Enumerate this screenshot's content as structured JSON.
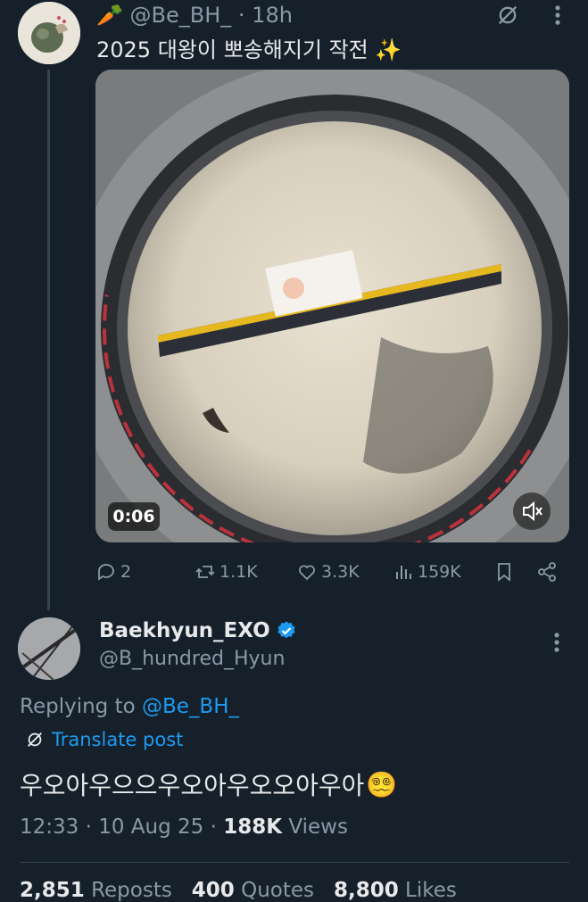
{
  "tweet1": {
    "carrot_emoji": "🥕",
    "handle": "@Be_BH_",
    "time": "· 18h",
    "text": "2025 대왕이 뽀송해지기 작전",
    "sparkle_emoji": "✨",
    "video_time": "0:06",
    "actions": {
      "replies": "2",
      "reposts": "1.1K",
      "likes": "3.3K",
      "views": "159K"
    }
  },
  "tweet2": {
    "name": "Baekhyun_EXO",
    "handle": "@B_hundred_Hyun",
    "replying_prefix": "Replying to ",
    "replying_to": "@Be_BH_",
    "translate_label": "Translate post",
    "text": "우오아우으으우오아우오오아우아",
    "emoji": "😵‍💫",
    "time": "12:33 · 10 Aug 25 · ",
    "views_count": "188K",
    "views_label": " Views",
    "stats": {
      "reposts_count": "2,851",
      "reposts_label": " Reposts",
      "quotes_count": "400",
      "quotes_label": " Quotes",
      "likes_count": "8,800",
      "likes_label": " Likes"
    }
  },
  "colors": {
    "background": "#15202b",
    "text_primary": "#e7e9ea",
    "text_secondary": "#8b98a5",
    "accent": "#1d9bf0",
    "divider": "#38444d"
  }
}
